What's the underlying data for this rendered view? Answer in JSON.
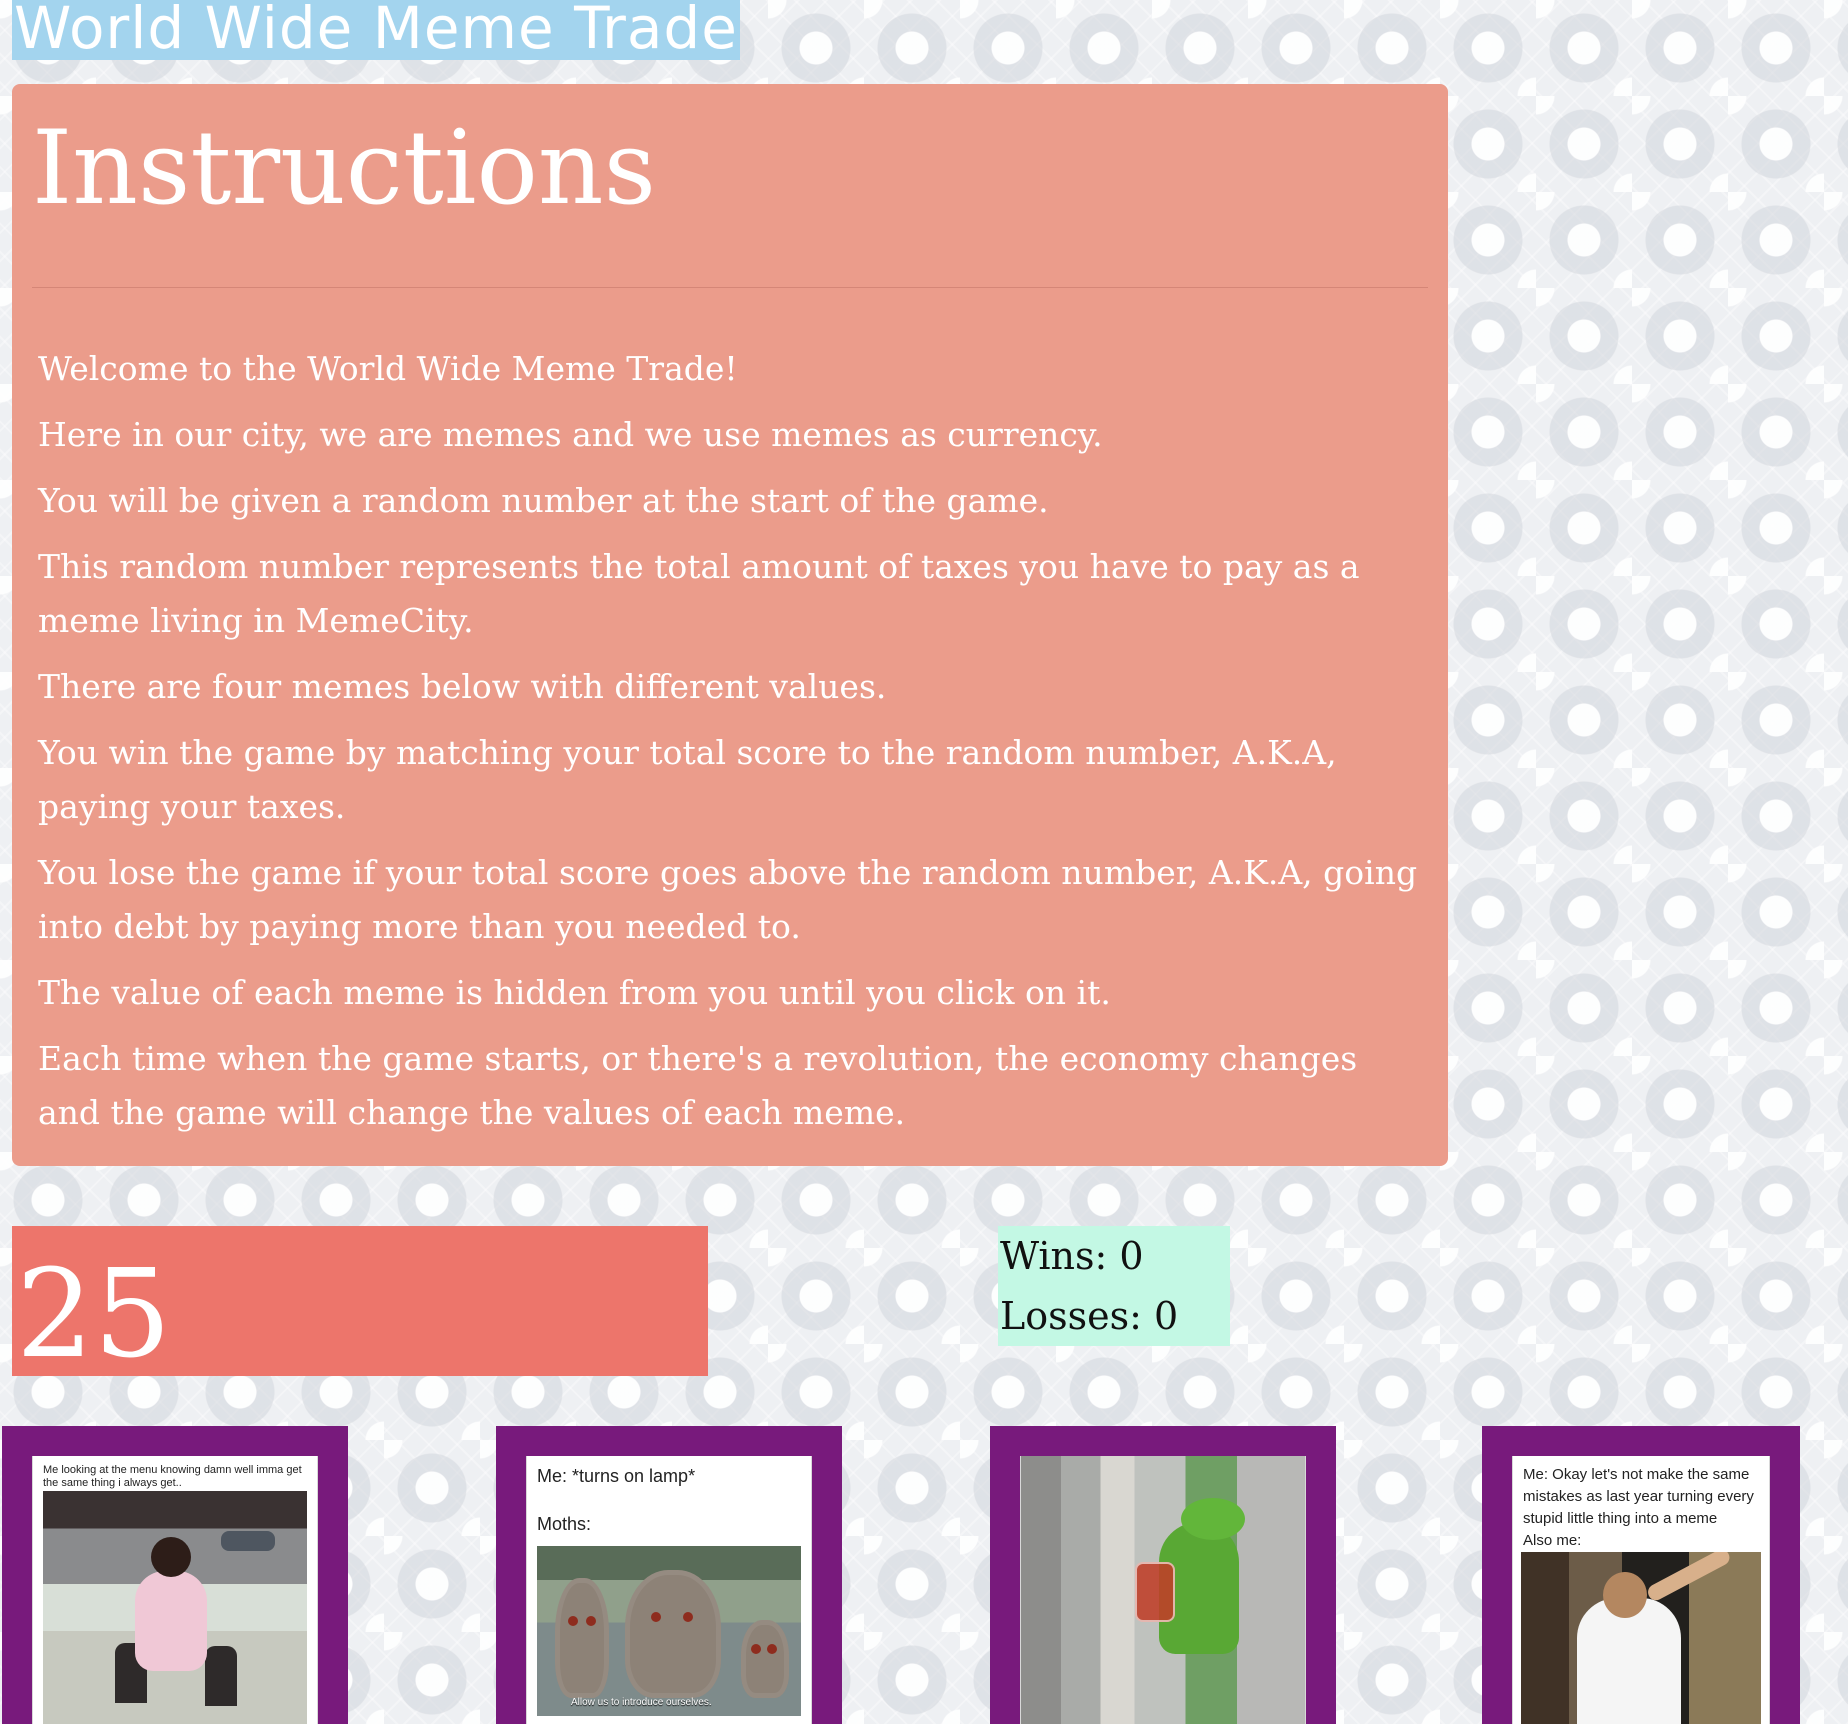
{
  "header": {
    "title": "World Wide Meme Trade"
  },
  "instructions": {
    "heading": "Instructions",
    "paragraphs": [
      "Welcome to the World Wide Meme Trade!",
      "Here in our city, we are memes and we use memes as currency.",
      "You will be given a random number at the start of the game.",
      "This random number represents the total amount of taxes you have to pay as a meme living in MemeCity.",
      "There are four memes below with different values.",
      "You win the game by matching your total score to the random number, A.K.A, paying your taxes.",
      "You lose the game if your total score goes above the random number, A.K.A, going into debt by paying more than you needed to.",
      "The value of each meme is hidden from you until you click on it.",
      "Each time when the game starts, or there's a revolution, the economy changes and the game will change the values of each meme."
    ]
  },
  "game": {
    "target": "25",
    "wins_text": "Wins: 0",
    "losses_text": "Losses: 0"
  },
  "memes": [
    {
      "caption": "Me looking at the menu knowing damn well imma get the same thing i always get.."
    },
    {
      "caption": "Me: *turns on lamp*\n\nMoths:",
      "overlay": "Allow us to introduce ourselves."
    },
    {
      "caption": ""
    },
    {
      "caption": "Me: Okay let's not make the same mistakes as last year turning every stupid little thing into a meme\nAlso me:"
    }
  ],
  "colors": {
    "title_bg": "#a3d4ee",
    "instructions_bg": "#eb9c8b",
    "target_bg": "#ed756b",
    "scoreboard_bg": "#c3f8e4",
    "card_border": "#781a7c"
  },
  "icons": []
}
